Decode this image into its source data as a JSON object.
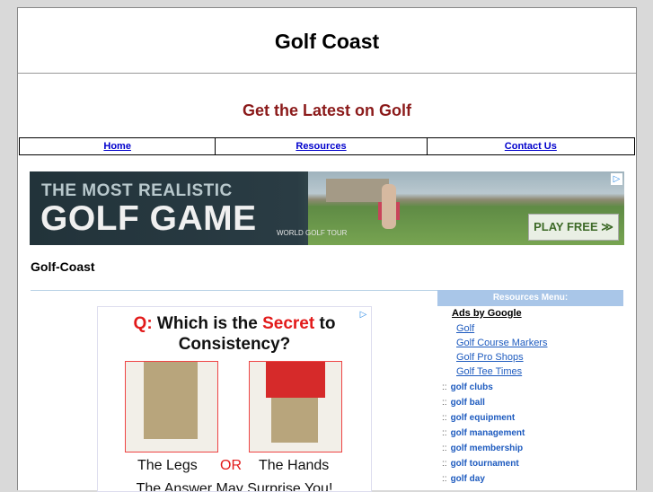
{
  "header": {
    "title": "Golf Coast",
    "tagline": "Get the Latest on Golf"
  },
  "nav": {
    "items": [
      {
        "label": "Home"
      },
      {
        "label": "Resources"
      },
      {
        "label": "Contact Us"
      }
    ]
  },
  "banner_ad": {
    "line1": "THE MOST REALISTIC",
    "line2": "GOLF GAME",
    "tour": "WORLD GOLF TOUR",
    "cta": "PLAY FREE ≫",
    "adchoice": "▷"
  },
  "main": {
    "heading": "Golf-Coast"
  },
  "content_ad": {
    "q_prefix": "Q:",
    "q_part1": " Which is the ",
    "q_secret": "Secret",
    "q_part2": " to Consistency?",
    "option1": "The Legs",
    "or": "OR",
    "option2": "The Hands",
    "answer": "The Answer May Surprise You!",
    "adchoice": "▷"
  },
  "sidebar": {
    "header": "Resources Menu:",
    "ads_label": "Ads by Google",
    "ad_links": [
      "Golf",
      "Golf Course Markers",
      "Golf Pro Shops",
      "Golf Tee Times"
    ],
    "bullet": "::",
    "items": [
      "golf clubs",
      "golf ball",
      "golf equipment",
      "golf management",
      "golf membership",
      "golf tournament",
      "golf day"
    ]
  }
}
